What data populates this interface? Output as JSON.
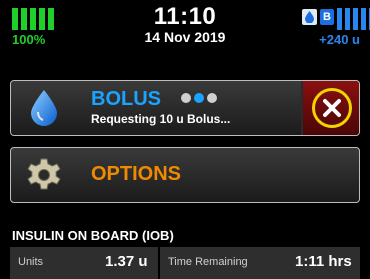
{
  "status": {
    "battery_percent": "100%",
    "time": "11:10",
    "date": "14 Nov 2019",
    "reservoir_units": "+240 u",
    "mode_badge": "B"
  },
  "bolus": {
    "title": "BOLUS",
    "subtitle": "Requesting 10 u Bolus..."
  },
  "options": {
    "label": "OPTIONS"
  },
  "iob": {
    "title": "INSULIN ON BOARD (IOB)",
    "units_label": "Units",
    "units_value": "1.37 u",
    "time_label": "Time Remaining",
    "time_value": "1:11 hrs"
  },
  "icons": {
    "drop": "drop-icon",
    "cancel": "close-icon",
    "gear": "gear-icon"
  },
  "colors": {
    "battery_green": "#1fcf2a",
    "reservoir_blue": "#2a86ee",
    "bolus_title": "#1aa3ff",
    "options_orange": "#f08a00",
    "cancel_ring": "#f0d400",
    "cancel_bg": "#7a0c0c"
  }
}
